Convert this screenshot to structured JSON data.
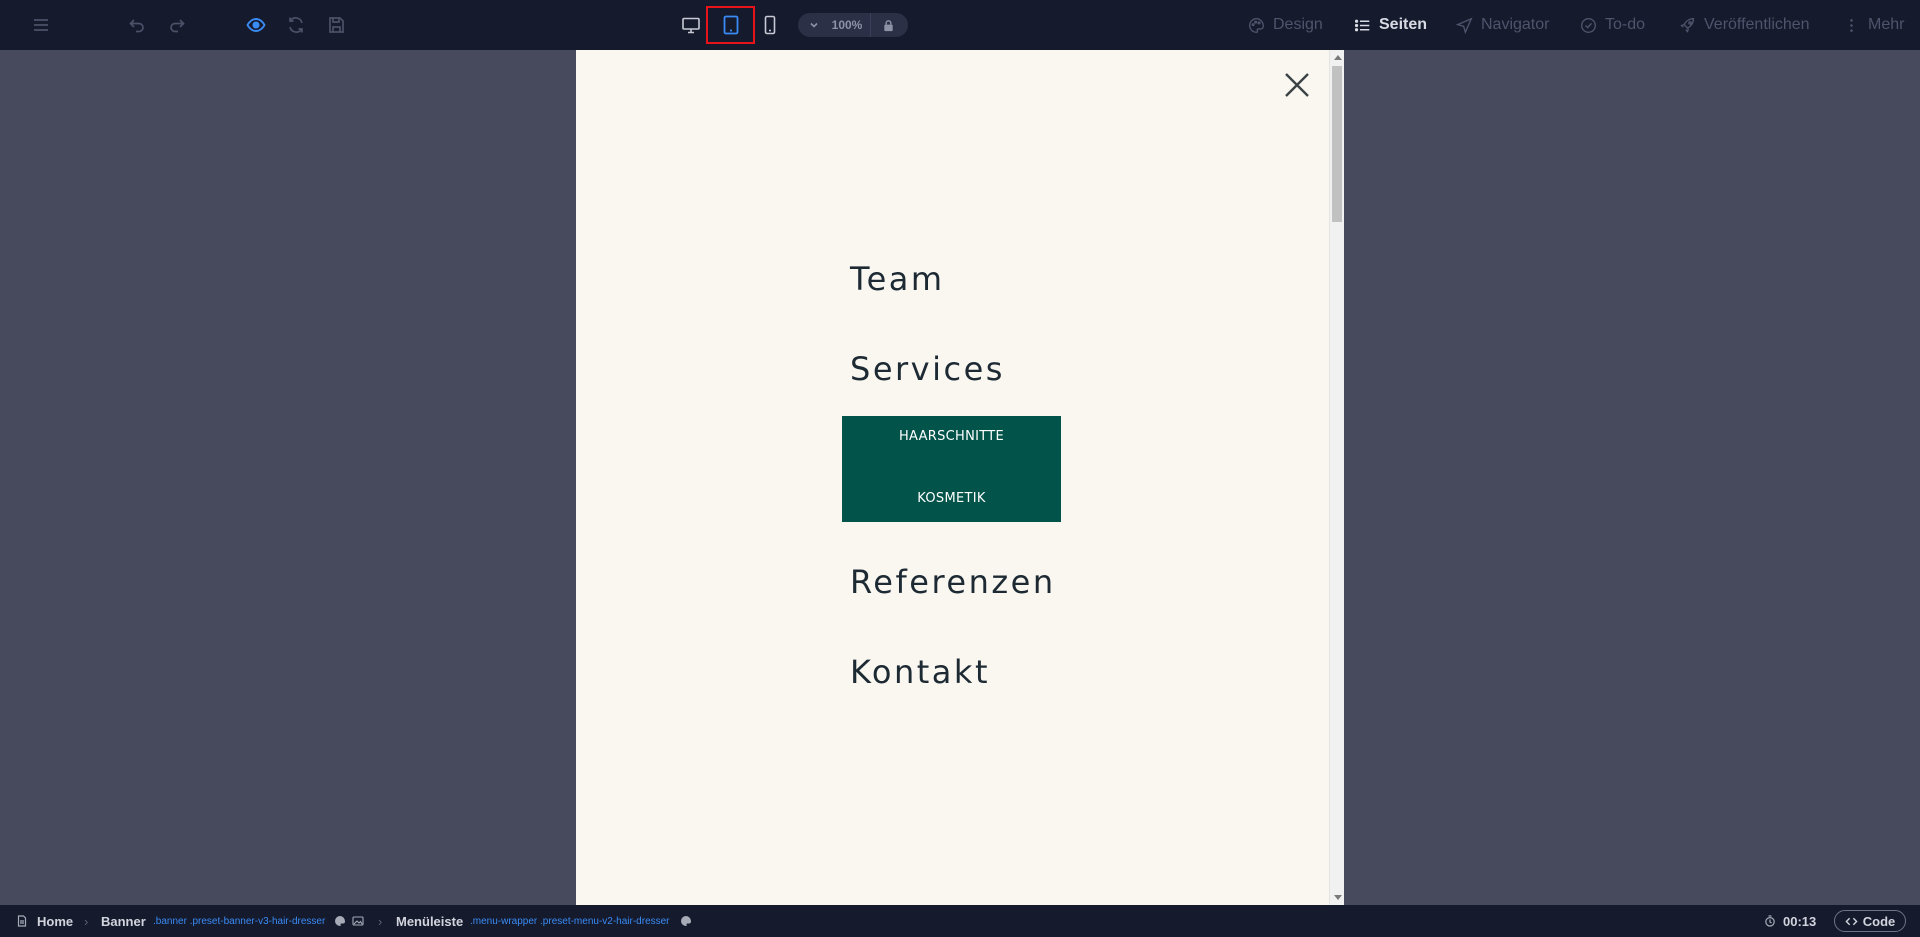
{
  "toolbar": {
    "zoom": "100%",
    "menu": {
      "design": "Design",
      "pages": "Seiten",
      "navigator": "Navigator",
      "todo": "To-do",
      "publish": "Veröffentlichen",
      "more": "Mehr"
    }
  },
  "preview": {
    "nav": {
      "team": "Team",
      "services": "Services",
      "sub": [
        "HAARSCHNITTE",
        "KOSMETIK"
      ],
      "references": "Referenzen",
      "contact": "Kontakt"
    },
    "colors": {
      "background": "#faf7f1",
      "submenu": "#02544a",
      "text": "#1d2a33"
    }
  },
  "statusbar": {
    "home": "Home",
    "banner": "Banner",
    "banner_classes": ".banner .preset-banner-v3-hair-dresser",
    "menu": "Menüleiste",
    "menu_classes": ".menu-wrapper .preset-menu-v2-hair-dresser",
    "timer": "00:13",
    "code": "Code"
  },
  "colors": {
    "toolbar": "#151a2d",
    "workspace": "#464a5c",
    "accent": "#3a8cf5",
    "highlight": "#e8141a"
  },
  "icons": [
    "hamburger-icon",
    "undo-icon",
    "redo-icon",
    "eye-icon",
    "refresh-icon",
    "save-icon",
    "desktop-icon",
    "tablet-icon",
    "mobile-icon",
    "chevron-down-icon",
    "lock-icon",
    "palette-icon",
    "list-icon",
    "navigator-icon",
    "check-circle-icon",
    "rocket-icon",
    "kebab-icon",
    "close-icon",
    "file-icon",
    "image-icon",
    "timer-icon",
    "code-icon"
  ]
}
